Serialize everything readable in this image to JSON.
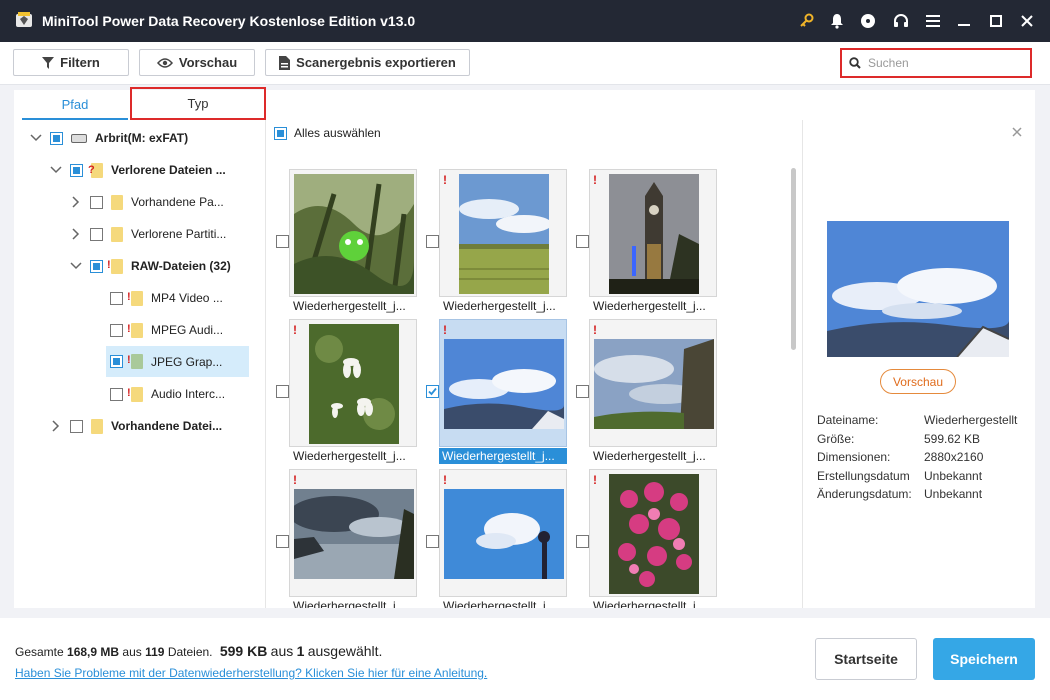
{
  "window": {
    "title": "MiniTool Power Data Recovery Kostenlose Edition v13.0"
  },
  "toolbar": {
    "filter_label": "Filtern",
    "preview_label": "Vorschau",
    "export_label": "Scanergebnis exportieren",
    "search_placeholder": "Suchen"
  },
  "tabs": {
    "path": "Pfad",
    "type": "Typ",
    "active": "Pfad"
  },
  "tree": {
    "root": "Arbrit(M: exFAT)",
    "lost": "Verlorene Dateien ...",
    "existing_pa": "Vorhandene Pa...",
    "lost_part": "Verlorene Partiti...",
    "raw": "RAW-Dateien (32)",
    "mp4": "MP4 Video ...",
    "mpeg": "MPEG Audi...",
    "jpeg": "JPEG Grap...",
    "audio": "Audio Interc...",
    "existing_files": "Vorhandene Datei..."
  },
  "grid": {
    "select_all": "Alles auswählen",
    "items": [
      {
        "name": "Wiederhergestellt_j...",
        "selected": false
      },
      {
        "name": "Wiederhergestellt_j...",
        "selected": false
      },
      {
        "name": "Wiederhergestellt_j...",
        "selected": false
      },
      {
        "name": "Wiederhergestellt_j...",
        "selected": false
      },
      {
        "name": "Wiederhergestellt_j...",
        "selected": true
      },
      {
        "name": "Wiederhergestellt_j...",
        "selected": false
      },
      {
        "name": "Wiederhergestellt_j...",
        "selected": false
      },
      {
        "name": "Wiederhergestellt_j...",
        "selected": false
      },
      {
        "name": "Wiederhergestellt_j...",
        "selected": false
      }
    ]
  },
  "preview": {
    "button": "Vorschau",
    "labels": {
      "filename": "Dateiname:",
      "size": "Größe:",
      "dimensions": "Dimensionen:",
      "created": "Erstellungsdatum",
      "modified": "Änderungsdatum:"
    },
    "values": {
      "filename": "Wiederhergestellt",
      "size": "599.62 KB",
      "dimensions": "2880x2160",
      "created": "Unbekannt",
      "modified": "Unbekannt"
    }
  },
  "footer": {
    "total_prefix": "Gesamte",
    "total_size": "168,9 MB",
    "from": "aus",
    "file_count": "119",
    "files_word": "Dateien.",
    "selected_size": "599 KB",
    "from2": "aus",
    "selected_count": "1",
    "selected_word": "ausgewählt.",
    "help_link": "Haben Sie Probleme mit der Datenwiederherstellung? Klicken Sie hier für eine Anleitung.",
    "home_button": "Startseite",
    "save_button": "Speichern"
  },
  "colors": {
    "accent": "#2a8fd8",
    "highlight": "#dd2a2a",
    "save": "#35a7e6",
    "titlebar": "#232834"
  }
}
